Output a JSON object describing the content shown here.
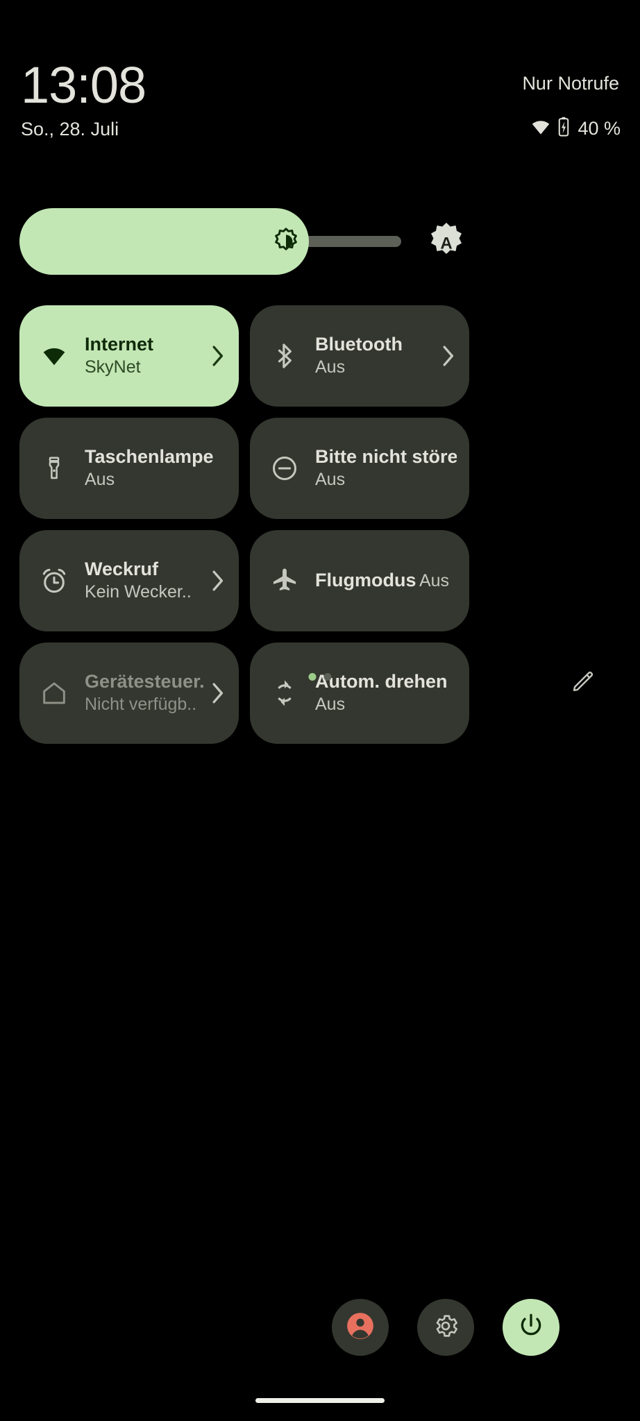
{
  "status": {
    "time": "13:08",
    "carrier": "Nur Notrufe",
    "date": "So., 28. Juli",
    "battery_text": "40 %",
    "wifi_icon": "wifi-icon",
    "battery_icon": "battery-charging-icon"
  },
  "brightness": {
    "name": "brightness-slider",
    "value_percent": 76,
    "icon": "brightness-icon",
    "auto_label": "A",
    "auto_icon": "auto-brightness-icon",
    "fill_color": "#c2e7b4",
    "track_color": "#5c6057"
  },
  "tiles": [
    {
      "label": "Internet",
      "sub": "SkyNet",
      "icon": "wifi-icon",
      "name": "tile-internet",
      "active": true,
      "chevron": true,
      "dim": false
    },
    {
      "label": "Bluetooth",
      "sub": "Aus",
      "icon": "bluetooth-icon",
      "name": "tile-bluetooth",
      "active": false,
      "chevron": true,
      "dim": false
    },
    {
      "label": "Taschenlampe",
      "sub": "Aus",
      "icon": "flashlight-icon",
      "name": "tile-flashlight",
      "active": false,
      "chevron": false,
      "dim": false
    },
    {
      "label": "Bitte nicht stören",
      "sub": "Aus",
      "icon": "do-not-disturb-icon",
      "name": "tile-do-not-disturb",
      "active": false,
      "chevron": false,
      "dim": false
    },
    {
      "label": "Weckruf",
      "sub": "Kein Wecker..",
      "icon": "alarm-icon",
      "name": "tile-alarm",
      "active": false,
      "chevron": true,
      "dim": false
    },
    {
      "label": "Flugmodus",
      "sub": "Aus",
      "icon": "airplane-icon",
      "name": "tile-airplane-mode",
      "active": false,
      "chevron": false,
      "dim": false
    },
    {
      "label": "Gerätesteuer..",
      "sub": "Nicht verfügb..",
      "icon": "home-icon",
      "name": "tile-device-controls",
      "active": false,
      "chevron": true,
      "dim": true
    },
    {
      "label": "Autom. drehen",
      "sub": "Aus",
      "icon": "auto-rotate-icon",
      "name": "tile-auto-rotate",
      "active": false,
      "chevron": false,
      "dim": false
    }
  ],
  "pager": {
    "pages": 2,
    "current": 1,
    "edit_icon": "pencil-icon"
  },
  "footer": {
    "user_icon": "user-avatar-icon",
    "settings_icon": "gear-icon",
    "power_icon": "power-icon",
    "user_color": "#e8705f",
    "power_bg": "#c2e7b4"
  }
}
